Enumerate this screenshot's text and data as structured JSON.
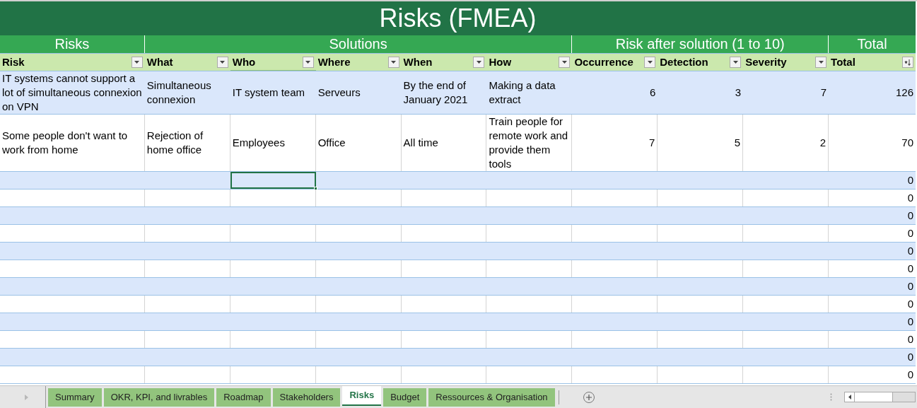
{
  "title": "Risks (FMEA)",
  "groups": [
    {
      "label": "Risks"
    },
    {
      "label": "Solutions"
    },
    {
      "label": "Risk after solution (1 to 10)"
    },
    {
      "label": "Total"
    }
  ],
  "columns": [
    {
      "label": "Risk",
      "kind": "filter",
      "selected": false
    },
    {
      "label": "What",
      "kind": "filter",
      "selected": false
    },
    {
      "label": "Who",
      "kind": "filter",
      "selected": true
    },
    {
      "label": "Where",
      "kind": "filter",
      "selected": false
    },
    {
      "label": "When",
      "kind": "filter",
      "selected": false
    },
    {
      "label": "How",
      "kind": "filter",
      "selected": false
    },
    {
      "label": "Occurrence",
      "kind": "filter",
      "selected": false
    },
    {
      "label": "Detection",
      "kind": "filter",
      "selected": false
    },
    {
      "label": "Severity",
      "kind": "filter",
      "selected": false
    },
    {
      "label": "Total",
      "kind": "sorted",
      "selected": false
    }
  ],
  "rows": [
    {
      "cells": [
        "IT systems cannot support a lot of simultaneous connexion on VPN",
        "Simultaneous connexion",
        "IT system team",
        "Serveurs",
        "By the end of January 2021",
        "Making a data extract",
        "6",
        "3",
        "7",
        "126"
      ]
    },
    {
      "cells": [
        "Some people don't want to work from home",
        "Rejection of home office",
        "Employees",
        "Office",
        "All time",
        "Train people for remote work and provide them tools",
        "7",
        "5",
        "2",
        "70"
      ]
    }
  ],
  "empty_rows": [
    {
      "total": "0",
      "selected": true
    },
    {
      "total": "0",
      "selected": false
    },
    {
      "total": "0",
      "selected": false
    },
    {
      "total": "0",
      "selected": false
    },
    {
      "total": "0",
      "selected": false
    },
    {
      "total": "0",
      "selected": false
    },
    {
      "total": "0",
      "selected": false
    },
    {
      "total": "0",
      "selected": false
    },
    {
      "total": "0",
      "selected": false
    },
    {
      "total": "0",
      "selected": false
    },
    {
      "total": "0",
      "selected": false
    },
    {
      "total": "0",
      "selected": false
    }
  ],
  "sheet_tabs": [
    {
      "label": "Summary",
      "selected": false
    },
    {
      "label": "OKR, KPI, and livrables",
      "selected": false
    },
    {
      "label": "Roadmap",
      "selected": false
    },
    {
      "label": "Stakeholders",
      "selected": false
    },
    {
      "label": "Risks",
      "selected": true
    },
    {
      "label": "Budget",
      "selected": false
    },
    {
      "label": "Ressources & Organisation",
      "selected": false
    }
  ]
}
